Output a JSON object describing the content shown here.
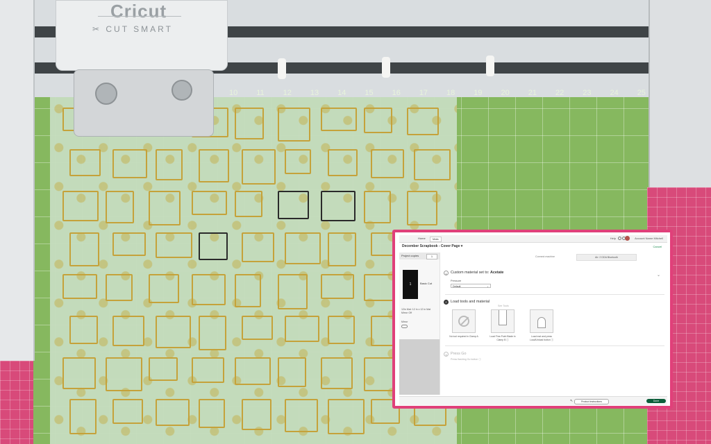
{
  "photo": {
    "machine": {
      "brand": "Cricut",
      "tagline": "✂ CUT SMART"
    },
    "mat_top_numbers": [
      "10",
      "11",
      "12",
      "13",
      "14",
      "15",
      "16",
      "17",
      "18",
      "19",
      "20",
      "21",
      "22",
      "23",
      "24",
      "25",
      "26",
      "27"
    ],
    "mat_side_numbers": [
      "12",
      "10"
    ]
  },
  "app": {
    "header": {
      "tabs": [
        {
          "label": "Home"
        },
        {
          "label": "Mats"
        }
      ],
      "help": "Help",
      "user": "Account Name Mitchell"
    },
    "project": {
      "title": "December Scrapbook - Cover Page ▾",
      "cancel": "Cancel"
    },
    "left_panel": {
      "copies_label": "Project copies",
      "copies_value": "1",
      "mat_number": "1",
      "mat_label": "Basic Cut",
      "mat_size": "12in Mat: 12 in x 12 in Mat  Mirror Off",
      "mirror_label": "Mirror"
    },
    "mode": {
      "left": "Connect machine",
      "right": "Air: 2 DDA Bluetooth"
    },
    "step1": {
      "num": "1",
      "title_prefix": "Custom material set to:",
      "material": "Acetate",
      "pressure_label": "Pressure",
      "pressure_value": "Default"
    },
    "step2": {
      "num": "2",
      "title": "Load tools and material",
      "see_all": "See Tools",
      "tools": [
        {
          "caption": "No tool required in Clamp A"
        },
        {
          "caption": "Load Fine-Point Blade in Clamp B ⓘ"
        },
        {
          "caption": "Load mat and press Load/Unload button ⓘ"
        }
      ]
    },
    "step3": {
      "num": "3",
      "title": "Press Go",
      "subtitle": "Press flashing Go button ⓘ"
    },
    "footer": {
      "production_label": "Product instructions",
      "done_label": "Done"
    }
  },
  "colors": {
    "frame": "#e0407a",
    "mat_green": "#86b85f",
    "done_button": "#0c5e3a"
  }
}
